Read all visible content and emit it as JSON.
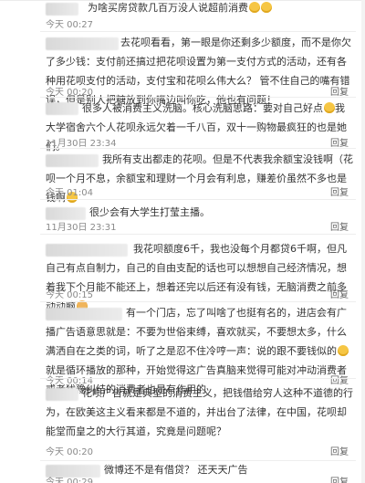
{
  "comments": [
    {
      "name_hidden": true,
      "text": "为啥买房贷款几百万没人说超前消费",
      "emoji": "laughing-tears-emoji-icon",
      "time": "今天 00:27",
      "reply": ""
    },
    {
      "name_hidden": true,
      "text": "去花呗看看，第一眼是你还剩多少额度，而不是你欠了多少钱：支付前还搞过把花呗设置为第一支付方式的活动，还有各种用花呗支付的活动，支付宝和花呗么伟大么？ 管不住自己的嘴有错误，但是别人把糖放到你嘴边叫你吃，他也有问题！",
      "emoji": "",
      "time": "今天 00:20",
      "reply": "回复"
    },
    {
      "name_hidden": true,
      "text": "很多人被消费主义洗脑。核心洗脑思路：要对自己好点",
      "emoji": "wink-emoji-icon",
      "text2": "我大学宿舍六个人花呗永远欠着一千八百，双十一购物最疯狂的也是她们。",
      "time": "11月30日 23:34",
      "reply": "回复"
    },
    {
      "name_hidden": true,
      "text": "我所有支出都走的花呗。但是不代表我余额宝没钱啊（花呗一个月不息，余额宝和理财一个月会有利息，赚差价虽然不多也是钱啊",
      "emoji": "grin-emoji-icon",
      "time": "今天 01:04",
      "reply": "回复"
    },
    {
      "name_hidden": true,
      "text": "很少会有大学生打莹主播。",
      "emoji": "",
      "time": "11月30日 23:31",
      "reply": "回复"
    },
    {
      "name_hidden": true,
      "text": "我花呗额度6千，我也没每个月都贷6千啊，但凡自己有点自制力，自己的自由支配的话也可以想想自己经济情况，想着我下个月能不能还上，想着还完以后还有没有钱，无脑消费之前多动动脑",
      "emoji": "face-emoji-icon",
      "time": "今天 00:15",
      "reply": "回复"
    },
    {
      "name_hidden": true,
      "text": "有一个门店，忘了叫啥了也挺有名的，进店会有广播广告语意思就是：不要为世俗束缚，喜欢就买，不要想太多，什么满洒自在之类的词，听了之是忍不住冷哼一声：说的跟不要钱似的",
      "emoji": "smirk-emoji-icon",
      "text2": "就是循环播放的那种，开始觉得这广告真脑来觉得可能对冲动消费者或者犹豫纠结的消费者也是有作用的",
      "time": "今天 00:14",
      "reply": "回复"
    },
    {
      "name_hidden": true,
      "text": "花呗广告就是典型的消费主义，把钱借给穷人这种不道德的行为，在欧美这主义看来都是不道的，并出台了法律，在中国，花呗却能堂而皇之的大行其道，究竟是问题呢？",
      "emoji": "",
      "time": "今天 00:20",
      "reply": "回复"
    },
    {
      "name_hidden": true,
      "text": "微博还不是有借贷？ 还天天广告",
      "emoji": "",
      "time": "今天 00:29",
      "reply": "回复"
    }
  ]
}
